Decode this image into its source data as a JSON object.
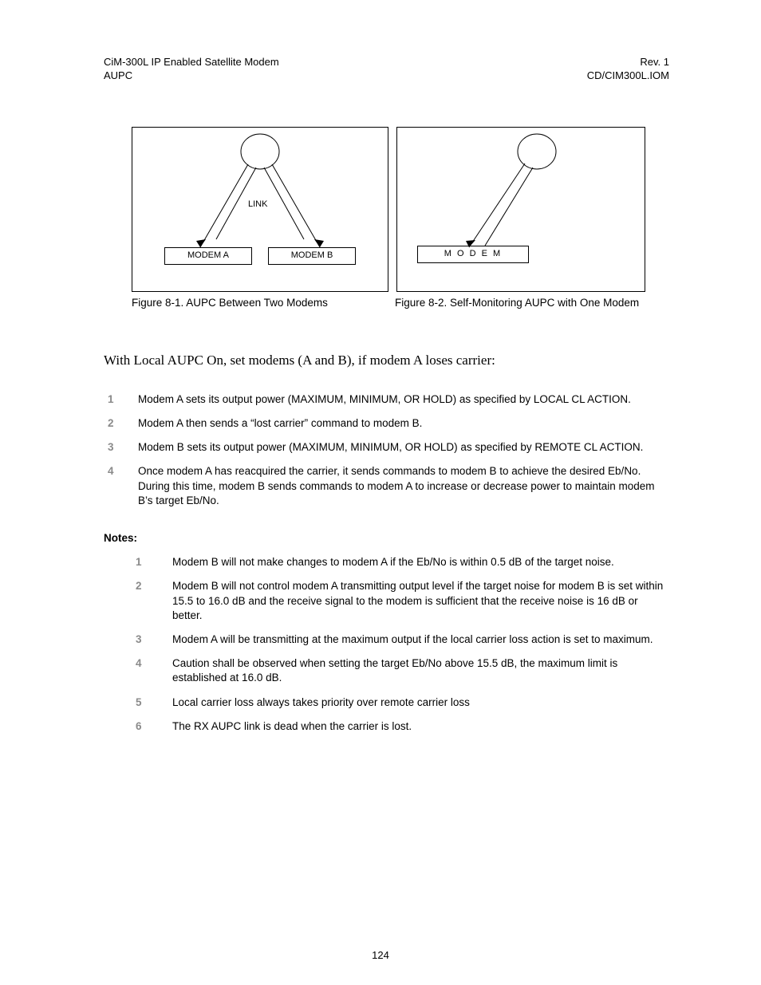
{
  "header": {
    "left_line1": "CiM-300L IP Enabled Satellite Modem",
    "left_line2": "AUPC",
    "right_line1": "Rev. 1",
    "right_line2": "CD/CIM300L.IOM"
  },
  "figures": {
    "fig1": {
      "link_label": "LINK",
      "modem_a": "MODEM A",
      "modem_b": "MODEM B",
      "caption": "Figure 8-1.  AUPC Between Two Modems"
    },
    "fig2": {
      "modem": "M O D E M",
      "caption": "Figure 8-2.  Self-Monitoring AUPC with One Modem"
    }
  },
  "intro": "With Local AUPC On, set modems (A and B), if modem A loses carrier:",
  "steps": [
    "Modem A sets its output power (MAXIMUM, MINIMUM, OR HOLD) as specified by LOCAL CL ACTION.",
    "Modem A then sends a “lost carrier” command to modem B.",
    "Modem B sets its output power (MAXIMUM, MINIMUM, OR HOLD) as specified by REMOTE CL ACTION.",
    "Once modem A has reacquired the carrier, it sends commands to modem B to achieve the desired Eb/No. During this time, modem B sends commands to modem A to increase or decrease power to maintain modem B’s target Eb/No."
  ],
  "notes_heading": "Notes:",
  "notes": [
    "Modem B will not make changes to modem A if the Eb/No is within 0.5 dB of the target noise.",
    "Modem B will not control modem A transmitting output level if the target noise for modem B is set within 15.5 to 16.0 dB and the receive signal to the modem is sufficient that the receive noise is 16 dB or better.",
    "Modem A will be transmitting at the maximum output if the local carrier loss action is set to maximum.",
    "Caution shall be observed when setting the target Eb/No above 15.5 dB, the maximum limit is established at 16.0 dB.",
    "Local carrier loss always takes priority over remote carrier loss",
    "The RX AUPC link is dead when the carrier is lost."
  ],
  "page_number": "124"
}
